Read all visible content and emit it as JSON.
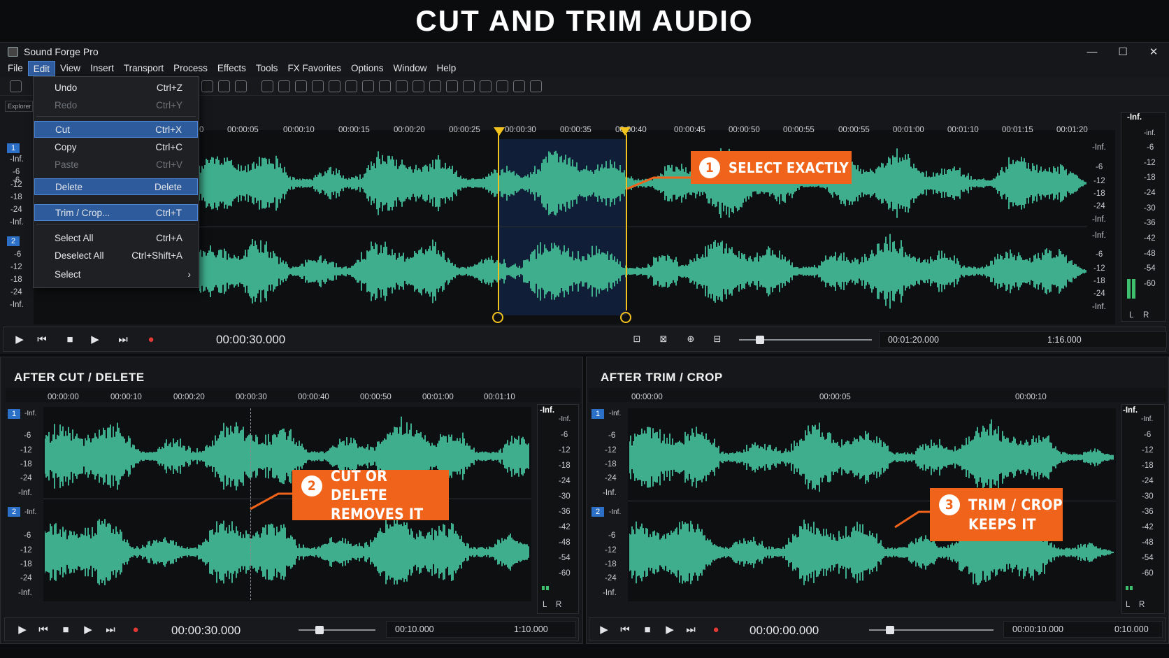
{
  "header": {
    "title": "CUT AND TRIM AUDIO"
  },
  "window": {
    "title": "Sound Forge Pro",
    "controls": [
      "—",
      "☐",
      "✕"
    ],
    "menu": [
      "File",
      "Edit",
      "View",
      "Insert",
      "Transport",
      "Process",
      "Effects",
      "Tools",
      "FX Favorites",
      "Options",
      "Window",
      "Help"
    ],
    "active_menu": "Edit",
    "explorer_tab": "Explorer"
  },
  "edit_menu": {
    "items": [
      {
        "label": "Undo",
        "shortcut": "Ctrl+Z",
        "state": "normal"
      },
      {
        "label": "Redo",
        "shortcut": "Ctrl+Y",
        "state": "disabled"
      },
      {
        "label": "Cut",
        "shortcut": "Ctrl+X",
        "state": "selected"
      },
      {
        "label": "Copy",
        "shortcut": "Ctrl+C",
        "state": "normal"
      },
      {
        "label": "Paste",
        "shortcut": "Ctrl+V",
        "state": "disabled"
      },
      {
        "label": "Delete",
        "shortcut": "Delete",
        "state": "selected"
      },
      {
        "label": "Trim / Crop...",
        "shortcut": "Ctrl+T",
        "state": "selected"
      },
      {
        "label": "Select All",
        "shortcut": "Ctrl+A",
        "state": "normal"
      },
      {
        "label": "Deselect All",
        "shortcut": "Ctrl+Shift+A",
        "state": "normal"
      },
      {
        "label": "Select",
        "shortcut": "›",
        "state": "normal"
      }
    ]
  },
  "main_editor": {
    "ruler": [
      "0",
      "00:00:05",
      "00:00:10",
      "00:00:15",
      "00:00:20",
      "00:00:25",
      "00:00:30",
      "00:00:35",
      "00:00:40",
      "00:00:45",
      "00:00:50",
      "00:00:55",
      "00:00:55",
      "00:01:00",
      "00:01:10",
      "00:01:15",
      "00:01:20"
    ],
    "left_scale_ch1": [
      "-Inf.",
      "-6",
      "-12",
      "-18",
      "-24",
      "-Inf."
    ],
    "left_scale_ch2": [
      "-6",
      "-12",
      "-18",
      "-24",
      "-Inf."
    ],
    "right_scale_ch1": [
      "-Inf.",
      "-6",
      "-12",
      "-18",
      "-24",
      "-Inf."
    ],
    "right_scale_ch2": [
      "-Inf.",
      "-6",
      "-12",
      "-18",
      "-24",
      "-Inf."
    ],
    "channels": [
      "1",
      "2"
    ],
    "meter_scale": [
      "-Inf.",
      "-inf.",
      "-6",
      "-12",
      "-18",
      "-24",
      "-30",
      "-36",
      "-42",
      "-48",
      "-54",
      "-60"
    ],
    "meter_lr": [
      "L",
      "R"
    ],
    "callout_num": "1",
    "callout_text": "SELECT EXACTLY",
    "transport_time": "00:00:30.000",
    "length_field": "00:01:20.000",
    "zoom_field": "1:16.000",
    "colors": {
      "waveform": "#3fae8c",
      "selection": "#1b2c52",
      "marker": "#f2c21d",
      "callout": "#f0631a",
      "channel_badge": "#2b6fc7"
    }
  },
  "after_cut": {
    "title": "AFTER CUT / DELETE",
    "ruler": [
      "00:00:00",
      "00:00:10",
      "00:00:20",
      "00:00:30",
      "00:00:40",
      "00:00:50",
      "00:01:00",
      "00:01:10"
    ],
    "scale_ch1": [
      "-Inf.",
      "-6",
      "-12",
      "-18",
      "-24",
      "-Inf."
    ],
    "scale_ch2": [
      "-Inf.",
      "-6",
      "-12",
      "-18",
      "-24",
      "-Inf."
    ],
    "meter_scale": [
      "-Inf.",
      "-Inf.",
      "-6",
      "-12",
      "-18",
      "-24",
      "-30",
      "-36",
      "-42",
      "-48",
      "-54",
      "-60"
    ],
    "meter_lr": [
      "L",
      "R"
    ],
    "callout_num": "2",
    "callout_line1": "CUT OR DELETE",
    "callout_line2": "REMOVES IT",
    "transport_time": "00:00:30.000",
    "length_field": "00:10.000",
    "zoom_field": "1:10.000"
  },
  "after_trim": {
    "title": "AFTER TRIM / CROP",
    "ruler": [
      "00:00:00",
      "00:00:05",
      "00:00:10"
    ],
    "scale_ch1": [
      "-Inf.",
      "-6",
      "-12",
      "-18",
      "-24",
      "-Inf."
    ],
    "scale_ch2": [
      "-Inf.",
      "-6",
      "-12",
      "-18",
      "-24",
      "-Inf."
    ],
    "meter_scale": [
      "-Inf.",
      "-Inf.",
      "-6",
      "-12",
      "-18",
      "-24",
      "-30",
      "-36",
      "-42",
      "-48",
      "-54",
      "-60"
    ],
    "meter_lr": [
      "L",
      "R"
    ],
    "callout_num": "3",
    "callout_line1": "TRIM / CROP",
    "callout_line2": "KEEPS IT",
    "transport_time": "00:00:00.000",
    "length_field": "00:00:10.000",
    "zoom_field": "0:10.000"
  },
  "transport_icons": [
    "play-icon",
    "rewind-icon",
    "stop-icon",
    "play-icon",
    "skip-end-icon",
    "record-icon"
  ]
}
